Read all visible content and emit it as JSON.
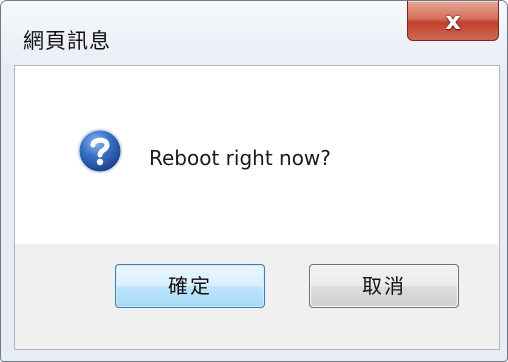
{
  "window": {
    "title": "網頁訊息",
    "close_glyph": "x"
  },
  "message": {
    "icon": "question-icon",
    "text": "Reboot right now?"
  },
  "buttons": {
    "ok_label": "確定",
    "cancel_label": "取消"
  },
  "colors": {
    "close_button": "#c75a45",
    "ok_button_border": "#3c7fb1",
    "icon_blue": "#2e62b6"
  }
}
